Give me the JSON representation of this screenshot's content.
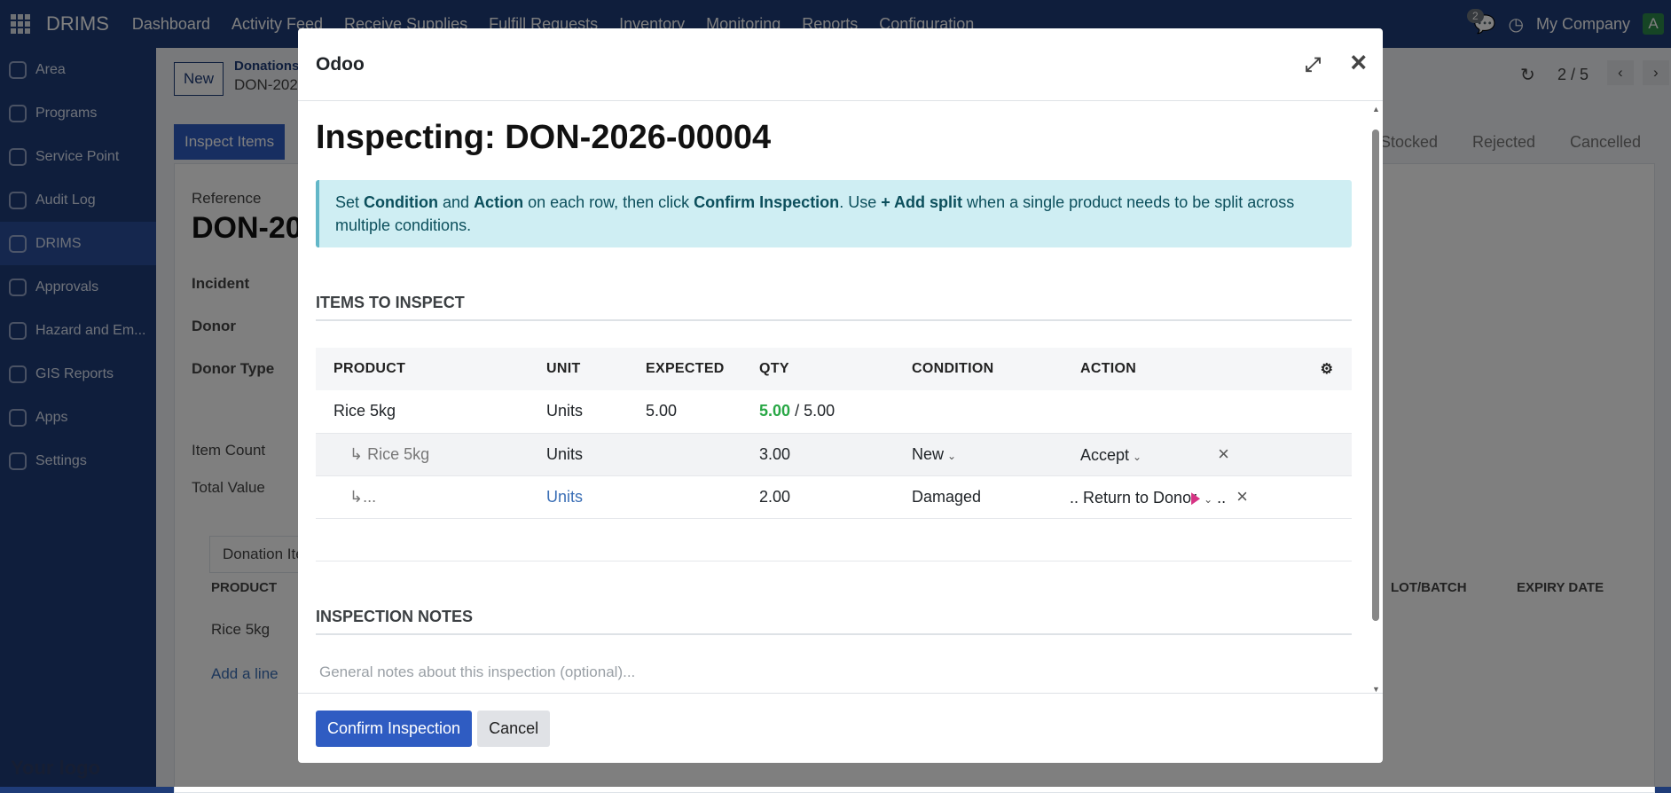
{
  "topbar": {
    "app_name": "DRIMS",
    "menu": [
      "Dashboard",
      "Activity Feed",
      "Receive Supplies",
      "Fulfill Requests",
      "Inventory",
      "Monitoring",
      "Reports",
      "Configuration"
    ],
    "messages_count": "2",
    "company": "My Company",
    "avatar": "A"
  },
  "sidebar": {
    "items": [
      {
        "label": "Area",
        "icon": "map-pin-icon"
      },
      {
        "label": "Programs",
        "icon": "network-icon"
      },
      {
        "label": "Service Point",
        "icon": "map-pin-icon"
      },
      {
        "label": "Audit Log",
        "icon": "chart-icon"
      },
      {
        "label": "DRIMS",
        "icon": "network-icon",
        "active": true
      },
      {
        "label": "Approvals",
        "icon": "approvals-icon"
      },
      {
        "label": "Hazard and Em...",
        "icon": "hazard-icon"
      },
      {
        "label": "GIS Reports",
        "icon": "report-icon"
      },
      {
        "label": "Apps",
        "icon": "apps-icon"
      },
      {
        "label": "Settings",
        "icon": "gear-icon"
      }
    ],
    "logo": "Your logo"
  },
  "background": {
    "new_button": "New",
    "breadcrumb_parent": "Donations",
    "breadcrumb_current": "DON-202",
    "inspect_button": "Inspect Items",
    "pager": "2 / 5",
    "statuses": [
      "Stocked",
      "Rejected",
      "Cancelled"
    ],
    "reference_label": "Reference",
    "reference_value": "DON-20",
    "fields": [
      "Incident",
      "Donor",
      "Donor Type",
      "Item Count",
      "Total Value"
    ],
    "tab": "Donation Iter",
    "columns": [
      "PRODUCT",
      "LOT/BATCH",
      "EXPIRY DATE"
    ],
    "row_product": "Rice 5kg",
    "add_line": "Add a line"
  },
  "modal": {
    "header_title": "Odoo",
    "title": "Inspecting: DON-2026-00004",
    "alert": {
      "p1": "Set ",
      "b1": "Condition",
      "p2": " and ",
      "b2": "Action",
      "p3": " on each row, then click ",
      "b3": "Confirm Inspection",
      "p4": ". Use ",
      "b4": "+ Add split",
      "p5": " when a single product needs to be split across multiple conditions."
    },
    "items_section": "ITEMS TO INSPECT",
    "columns": [
      "PRODUCT",
      "UNIT",
      "EXPECTED",
      "QTY",
      "CONDITION",
      "ACTION"
    ],
    "rows": [
      {
        "product": "Rice 5kg",
        "unit": "Units",
        "expected": "5.00",
        "qty_done": "5.00",
        "qty_total": "/ 5.00"
      },
      {
        "product": "↳ Rice 5kg",
        "unit": "Units",
        "qty": "3.00",
        "condition": "New",
        "action": "Accept"
      },
      {
        "product": "↳...",
        "unit": "Units",
        "qty": "2.00",
        "condition": "Damaged",
        "action": ".. Return to Donor",
        "action_suffix": ".."
      }
    ],
    "notes_section": "INSPECTION NOTES",
    "notes_placeholder": "General notes about this inspection (optional)...",
    "confirm_button": "Confirm Inspection",
    "cancel_button": "Cancel"
  }
}
